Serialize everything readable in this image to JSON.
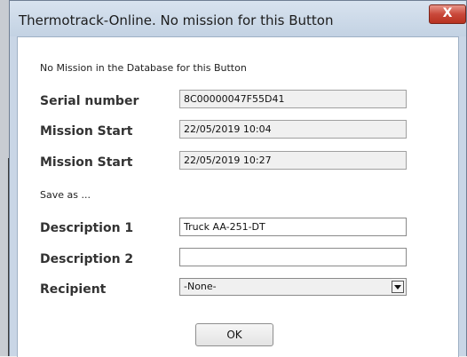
{
  "window": {
    "title": "Thermotrack-Online. No mission for this Button",
    "close_symbol": "X"
  },
  "message": "No Mission in the Database for this Button",
  "fields": {
    "serial_number": {
      "label": "Serial number",
      "value": "8C00000047F55D41"
    },
    "mission_start_1": {
      "label": "Mission Start",
      "value": "22/05/2019 10:04"
    },
    "mission_start_2": {
      "label": "Mission Start",
      "value": "22/05/2019 10:27"
    }
  },
  "save_as_label": "Save as ...",
  "inputs": {
    "description_1": {
      "label": "Description 1",
      "value": "Truck AA-251-DT"
    },
    "description_2": {
      "label": "Description 2",
      "value": ""
    },
    "recipient": {
      "label": "Recipient",
      "selected": "-None-"
    }
  },
  "ok_label": "OK",
  "icons": {
    "close": "close-icon",
    "dropdown": "chevron-down-icon"
  },
  "colors": {
    "close_button": "#c9483a",
    "title_bar": "#c9d6e6"
  }
}
